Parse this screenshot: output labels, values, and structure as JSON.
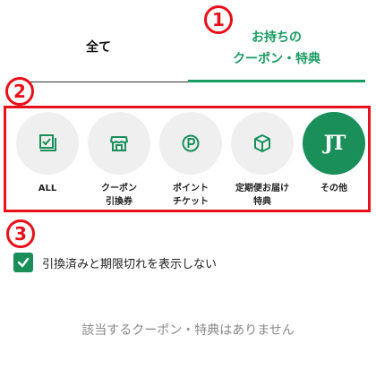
{
  "tabs": [
    {
      "label": "全て"
    },
    {
      "label": "お持ちの\nクーポン・特典"
    }
  ],
  "markers": [
    "1",
    "2",
    "3"
  ],
  "filters": [
    {
      "label": "ALL",
      "icon": "checklist-icon"
    },
    {
      "label": "クーポン\n引換券",
      "icon": "store-icon"
    },
    {
      "label": "ポイント\nチケット",
      "icon": "point-icon"
    },
    {
      "label": "定期便お届け\n特典",
      "icon": "box-icon"
    },
    {
      "label": "その他",
      "icon": "jt-logo",
      "mark": "JT"
    }
  ],
  "checkbox": {
    "label": "引換済みと期限切れを表示しない",
    "checked": true
  },
  "empty_message": "該当するクーポン・特典はありません",
  "colors": {
    "accent": "#1a8f5a",
    "tab_active": "#1a9b61",
    "annotation": "#e8101a",
    "circle_bg": "#efefef"
  }
}
